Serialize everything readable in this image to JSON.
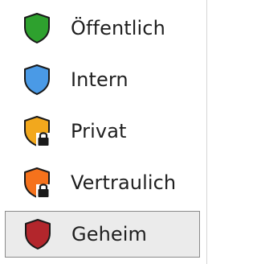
{
  "menu": {
    "items": [
      {
        "label": "Öffentlich",
        "icon": "shield-green-icon",
        "color": "#2ea12e",
        "locked": false,
        "selected": false
      },
      {
        "label": "Intern",
        "icon": "shield-blue-icon",
        "color": "#4a9ae6",
        "locked": false,
        "selected": false
      },
      {
        "label": "Privat",
        "icon": "shield-lock-orange-icon",
        "color": "#f2a81d",
        "locked": true,
        "selected": false
      },
      {
        "label": "Vertraulich",
        "icon": "shield-lock-deep-orange-icon",
        "color": "#f5721c",
        "locked": true,
        "selected": false
      },
      {
        "label": "Geheim",
        "icon": "shield-red-icon",
        "color": "#b3262c",
        "locked": false,
        "selected": true
      }
    ]
  }
}
